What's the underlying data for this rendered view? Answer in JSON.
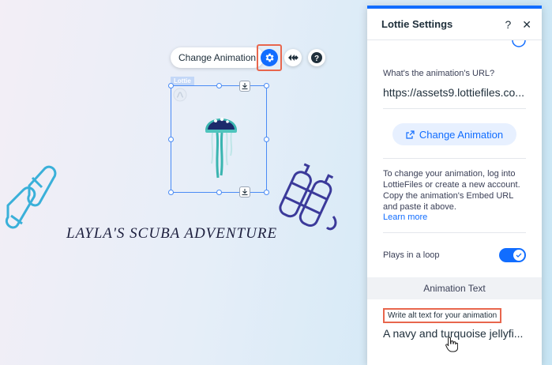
{
  "canvas": {
    "toolbar": {
      "change_animation": "Change Animation"
    },
    "lottie_tag": "Lottie",
    "site_title": "LAYLA'S SCUBA ADVENTURE"
  },
  "panel": {
    "title": "Lottie Settings",
    "help_icon": "?",
    "close_icon": "✕",
    "url_label": "What's the animation's URL?",
    "url_value": "https://assets9.lottiefiles.co...",
    "change_button": "Change Animation",
    "help_text": "To change your animation, log into LottieFiles or create a new account. Copy the animation's Embed URL and paste it above.",
    "learn_more": "Learn more",
    "loop_label": "Plays in a loop",
    "loop_on": true,
    "section_title": "Animation Text",
    "alt_label": "Write alt text for your animation",
    "alt_value": "A navy and turquoise jellyfi..."
  },
  "colors": {
    "accent": "#116dff",
    "highlight": "#e8664d",
    "title": "#1d1f3e"
  }
}
